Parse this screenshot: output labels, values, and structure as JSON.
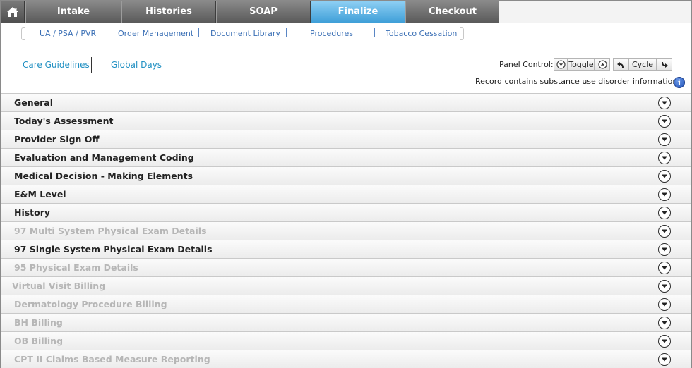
{
  "nav": {
    "tabs": [
      {
        "label": "Intake"
      },
      {
        "label": "Histories"
      },
      {
        "label": "SOAP"
      },
      {
        "label": "Finalize",
        "active": true
      },
      {
        "label": "Checkout"
      }
    ]
  },
  "subnav": {
    "links": [
      "UA / PSA / PVR",
      "Order Management",
      "Document Library",
      "Procedures",
      "Tobacco Cessation"
    ]
  },
  "toolbar": {
    "care_guidelines": "Care Guidelines",
    "global_days": "Global Days",
    "panel_control_label": "Panel Control:",
    "toggle_label": "Toggle",
    "cycle_label": "Cycle",
    "substance_label": "Record contains substance use disorder information",
    "info_glyph": "i"
  },
  "sections": [
    {
      "label": "General",
      "enabled": true
    },
    {
      "label": "Today's Assessment",
      "enabled": true
    },
    {
      "label": "Provider Sign Off",
      "enabled": true
    },
    {
      "label": "Evaluation and Management Coding",
      "enabled": true
    },
    {
      "label": "Medical Decision - Making Elements",
      "enabled": true
    },
    {
      "label": "E&M Level",
      "enabled": true
    },
    {
      "label": "History",
      "enabled": true
    },
    {
      "label": "97 Multi System Physical Exam Details",
      "enabled": false
    },
    {
      "label": "97 Single System Physical Exam Details",
      "enabled": true
    },
    {
      "label": "95 Physical Exam Details",
      "enabled": false
    },
    {
      "label": "Virtual Visit Billing",
      "enabled": false
    },
    {
      "label": "Dermatology Procedure Billing",
      "enabled": false
    },
    {
      "label": "BH Billing",
      "enabled": false
    },
    {
      "label": "OB Billing",
      "enabled": false
    },
    {
      "label": "CPT II Claims Based Measure Reporting",
      "enabled": false
    }
  ],
  "colors": {
    "active_tab": "#3f9fd8",
    "link": "#3a6fb5",
    "disabled_text": "#b6b6b6"
  },
  "icons": {
    "home": "home-icon",
    "expand": "chevron-down-circle-icon",
    "collapse": "chevron-up-circle-icon",
    "cycle_back": "cycle-back-icon",
    "cycle_forward": "cycle-forward-icon",
    "info": "info-icon"
  }
}
